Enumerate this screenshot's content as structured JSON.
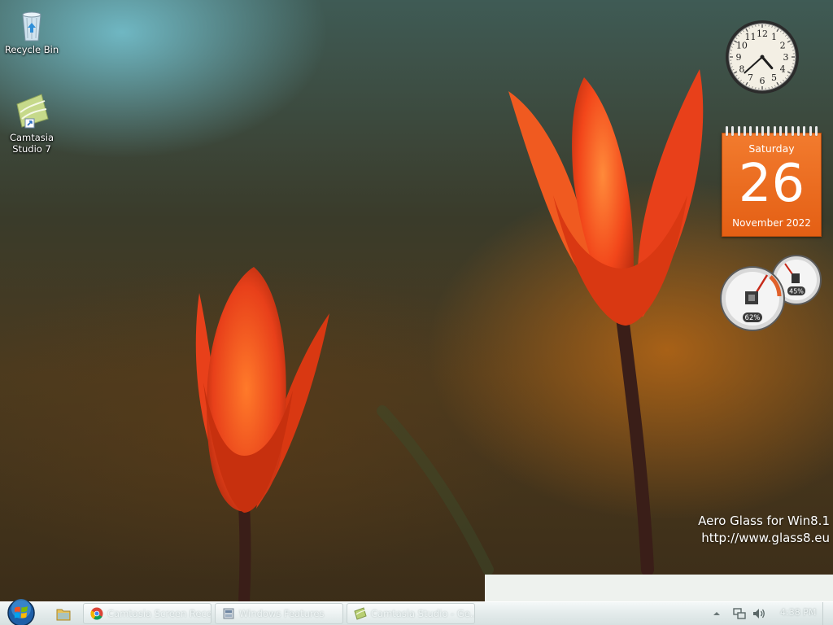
{
  "desktop": {
    "icons": [
      {
        "label_line1": "Recycle Bin",
        "label_line2": ""
      },
      {
        "label_line1": "Camtasia",
        "label_line2": "Studio 7"
      }
    ]
  },
  "gadgets": {
    "clock": {
      "numerals": [
        "12",
        "1",
        "2",
        "3",
        "4",
        "5",
        "6",
        "7",
        "8",
        "9",
        "10",
        "11"
      ],
      "time": "4:38"
    },
    "calendar": {
      "weekday": "Saturday",
      "day": "26",
      "month_year": "November 2022"
    },
    "meters": {
      "cpu_percent": "62%",
      "memory_percent": "45%"
    }
  },
  "watermark": {
    "line1": "Aero Glass for Win8.1",
    "line2": "http://www.glass8.eu"
  },
  "taskbar": {
    "buttons": [
      {
        "label": "Camtasia Screen Reco..."
      },
      {
        "label": "Windows Features"
      },
      {
        "label": "Camtasia Studio - Ge..."
      }
    ],
    "tray": {
      "time": "4:38 PM"
    }
  },
  "colors": {
    "calendar_orange": "#e8661c",
    "taskbar_glass": "#e3ebeb"
  }
}
